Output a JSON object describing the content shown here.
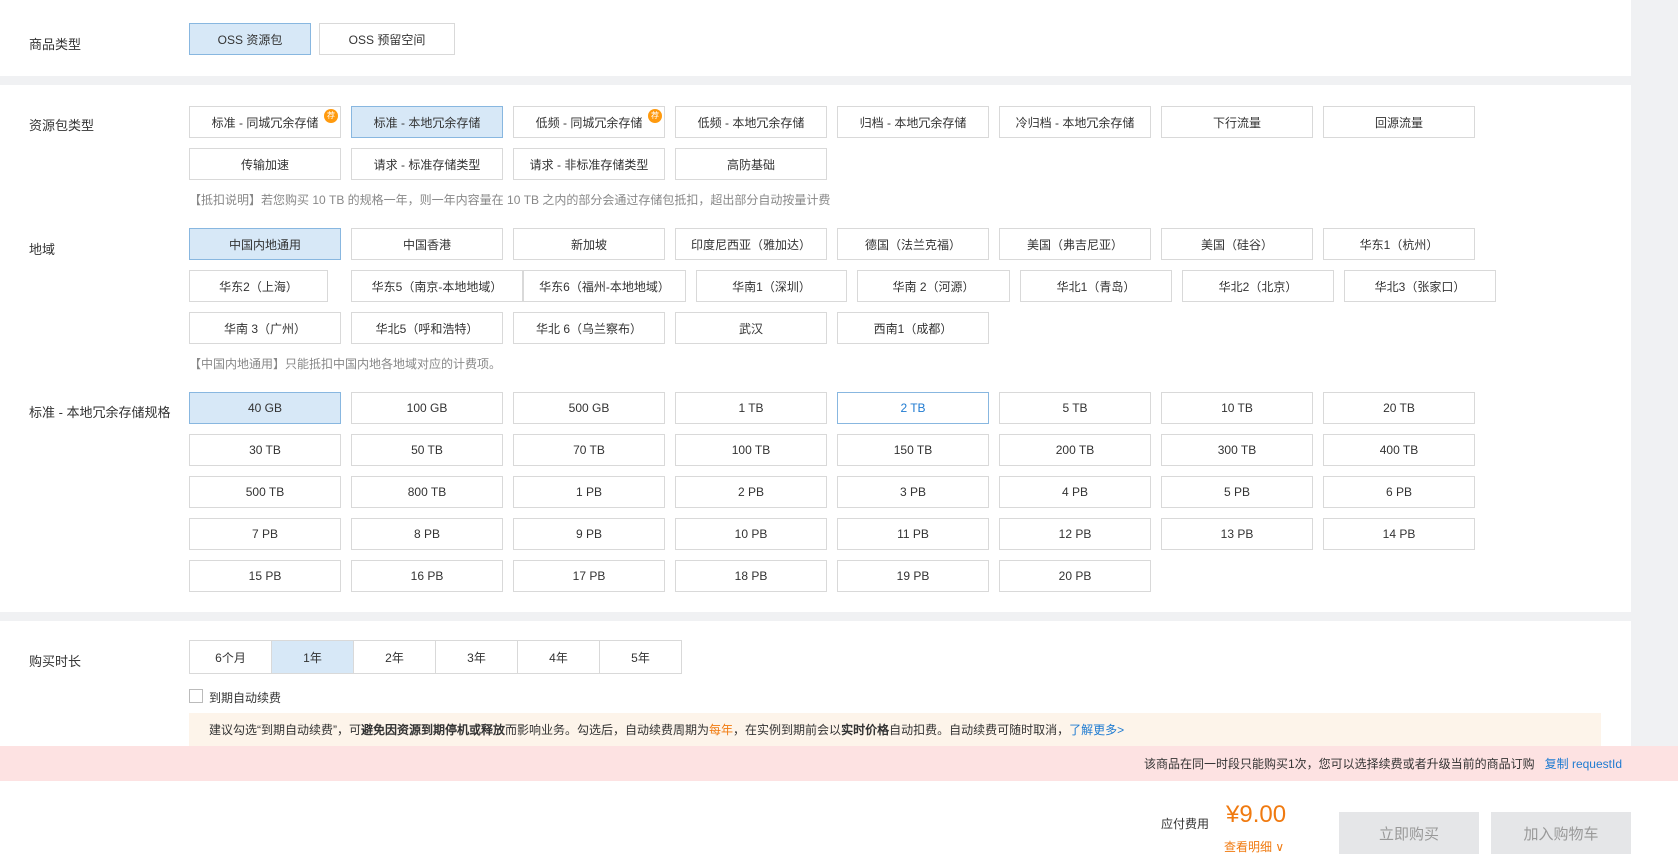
{
  "product_type": {
    "label": "商品类型",
    "options": [
      "OSS 资源包",
      "OSS 预留空间"
    ],
    "selected": 0
  },
  "package_type": {
    "label": "资源包类型",
    "options": [
      {
        "text": "标准 - 同城冗余存储",
        "badge": "荐"
      },
      {
        "text": "标准 - 本地冗余存储"
      },
      {
        "text": "低频 - 同城冗余存储",
        "badge": "荐"
      },
      {
        "text": "低频 - 本地冗余存储"
      },
      {
        "text": "归档 - 本地冗余存储"
      },
      {
        "text": "冷归档 - 本地冗余存储"
      },
      {
        "text": "下行流量"
      },
      {
        "text": "回源流量"
      },
      {
        "text": "传输加速"
      },
      {
        "text": "请求 - 标准存储类型"
      },
      {
        "text": "请求 - 非标准存储类型"
      },
      {
        "text": "高防基础"
      }
    ],
    "selected": 1,
    "note": "【抵扣说明】若您购买 10 TB 的规格一年，则一年内容量在 10 TB 之内的部分会通过存储包抵扣，超出部分自动按量计费"
  },
  "region": {
    "label": "地域",
    "options": [
      "中国内地通用",
      "中国香港",
      "新加坡",
      "印度尼西亚（雅加达）",
      "德国（法兰克福）",
      "美国（弗吉尼亚）",
      "美国（硅谷）",
      "华东1（杭州）",
      "华东2（上海）",
      "华东5（南京-本地地域）",
      "华东6（福州-本地地域）",
      "华南1（深圳）",
      "华南 2（河源）",
      "华北1（青岛）",
      "华北2（北京）",
      "华北3（张家口）",
      "华南 3（广州）",
      "华北5（呼和浩特）",
      "华北 6（乌兰察布）",
      "武汉",
      "西南1（成都）"
    ],
    "selected": 0,
    "note": "【中国内地通用】只能抵扣中国内地各地域对应的计费项。"
  },
  "spec": {
    "label": "标准 - 本地冗余存储规格",
    "options": [
      "40 GB",
      "100 GB",
      "500 GB",
      "1 TB",
      "2 TB",
      "5 TB",
      "10 TB",
      "20 TB",
      "30 TB",
      "50 TB",
      "70 TB",
      "100 TB",
      "150 TB",
      "200 TB",
      "300 TB",
      "400 TB",
      "500 TB",
      "800 TB",
      "1 PB",
      "2 PB",
      "3 PB",
      "4 PB",
      "5 PB",
      "6 PB",
      "7 PB",
      "8 PB",
      "9 PB",
      "10 PB",
      "11 PB",
      "12 PB",
      "13 PB",
      "14 PB",
      "15 PB",
      "16 PB",
      "17 PB",
      "18 PB",
      "19 PB",
      "20 PB"
    ],
    "selected": 0,
    "hovered": 4
  },
  "duration": {
    "label": "购买时长",
    "options": [
      "6个月",
      "1年",
      "2年",
      "3年",
      "4年",
      "5年"
    ],
    "selected": 1,
    "auto_renew_label": "到期自动续费"
  },
  "tip": {
    "t1": "建议勾选“到期自动续费”，可",
    "b1": "避免因资源到期停机或释放",
    "t2": "而影响业务。勾选后，自动续费周期为 ",
    "period": "每年",
    "t3": "，在实例到期前会以",
    "b2": "实时价格",
    "t4": "自动扣费。自动续费可随时取消，",
    "link": "了解更多>"
  },
  "alert": {
    "text": "该商品在同一时段只能购买1次，您可以选择续费或者升级当前的商品订购",
    "link": "复制 requestId"
  },
  "footer": {
    "fee_label": "应付费用",
    "fee_amount": "¥9.00",
    "detail": "查看明细 ∨",
    "buy_now": "立即购买",
    "add_cart": "加入购物车"
  },
  "colors": {
    "selected_bg": "#d7e8f7",
    "accent": "#1f7bd1",
    "price": "#f07a10",
    "alert_bg": "#fde2e2"
  }
}
